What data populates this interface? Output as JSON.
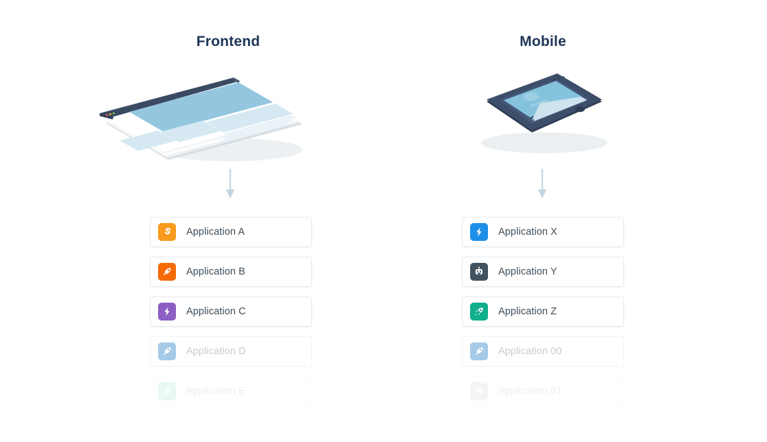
{
  "page": {
    "background": "#ffffff",
    "heading_color": "#1d3557",
    "label_color": "#3f4d58",
    "card_border_color": "#e7ebee",
    "arrow_color": "#c2d4e0"
  },
  "columns": [
    {
      "title": "Frontend",
      "illustration": "browser-window-isometric",
      "arrow": "down-arrow",
      "apps": [
        {
          "label": "Application A",
          "icon": "flash-s-icon",
          "icon_color": "#f99b1f",
          "state": "active"
        },
        {
          "label": "Application B",
          "icon": "rocket-icon",
          "icon_color": "#f56a08",
          "state": "active"
        },
        {
          "label": "Application C",
          "icon": "bolt-icon",
          "icon_color": "#8b5fc4",
          "state": "active"
        },
        {
          "label": "Application D",
          "icon": "rocket-icon",
          "icon_color": "#5d9fd6",
          "state": "faded"
        },
        {
          "label": "Application E",
          "icon": "rocket-icon",
          "icon_color": "#9fdcd4",
          "state": "more-faded"
        }
      ]
    },
    {
      "title": "Mobile",
      "illustration": "smartphone-isometric",
      "arrow": "down-arrow",
      "apps": [
        {
          "label": "Application X",
          "icon": "bolt-icon",
          "icon_color": "#1e8fe8",
          "state": "active"
        },
        {
          "label": "Application Y",
          "icon": "robot-icon",
          "icon_color": "#42525e",
          "state": "active"
        },
        {
          "label": "Application Z",
          "icon": "rocket-icon",
          "icon_color": "#0fae8c",
          "state": "active"
        },
        {
          "label": "Application 00",
          "icon": "rocket-icon",
          "icon_color": "#5d9fd6",
          "state": "faded"
        },
        {
          "label": "Application 01",
          "icon": "robot-icon",
          "icon_color": "#c8ced3",
          "state": "more-faded"
        }
      ]
    }
  ]
}
